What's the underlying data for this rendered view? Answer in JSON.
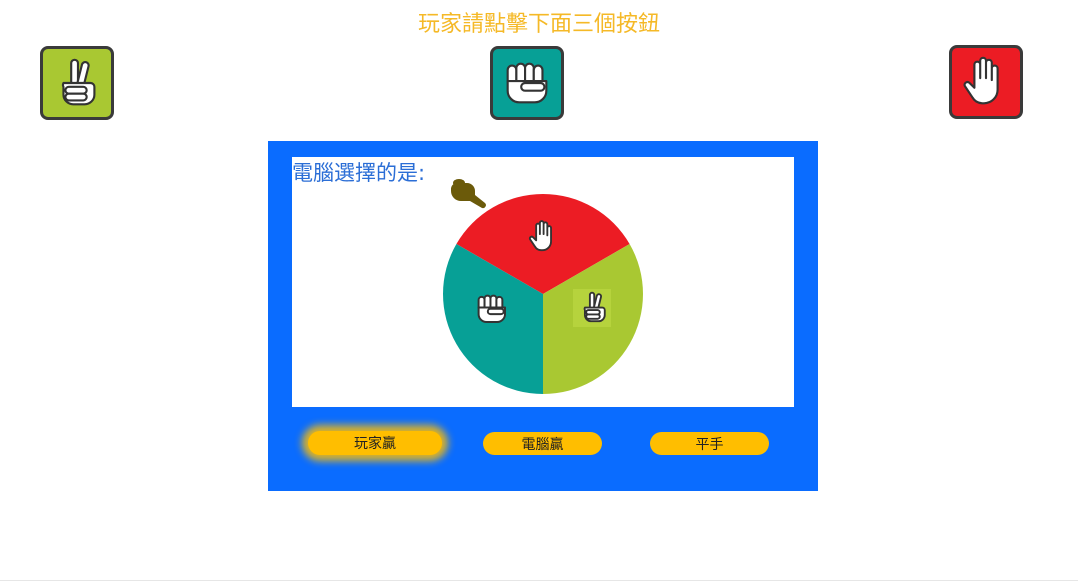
{
  "instruction": "玩家請點擊下面三個按鈕",
  "choices": [
    {
      "name": "scissors",
      "icon": "scissors-hand-icon",
      "color": "#a9c832"
    },
    {
      "name": "rock",
      "icon": "rock-fist-icon",
      "color": "#07a096"
    },
    {
      "name": "paper",
      "icon": "paper-hand-icon",
      "color": "#ec1c24"
    }
  ],
  "computer": {
    "label": "電腦選擇的是:",
    "wheel": [
      {
        "segment": "paper",
        "icon": "paper-hand-icon",
        "color": "#ec1c24"
      },
      {
        "segment": "scissors",
        "icon": "scissors-hand-icon",
        "color": "#a9c832"
      },
      {
        "segment": "rock",
        "icon": "rock-fist-icon",
        "color": "#07a096"
      }
    ],
    "pointer_icon": "pointing-hand-icon"
  },
  "results": {
    "player_win": "玩家贏",
    "computer_win": "電腦贏",
    "draw": "平手"
  },
  "colors": {
    "panel": "#0a6cff",
    "instruction": "#f5b927",
    "label": "#2b6ed6",
    "button": "#ffbe00",
    "pointer": "#6b5a0a"
  }
}
